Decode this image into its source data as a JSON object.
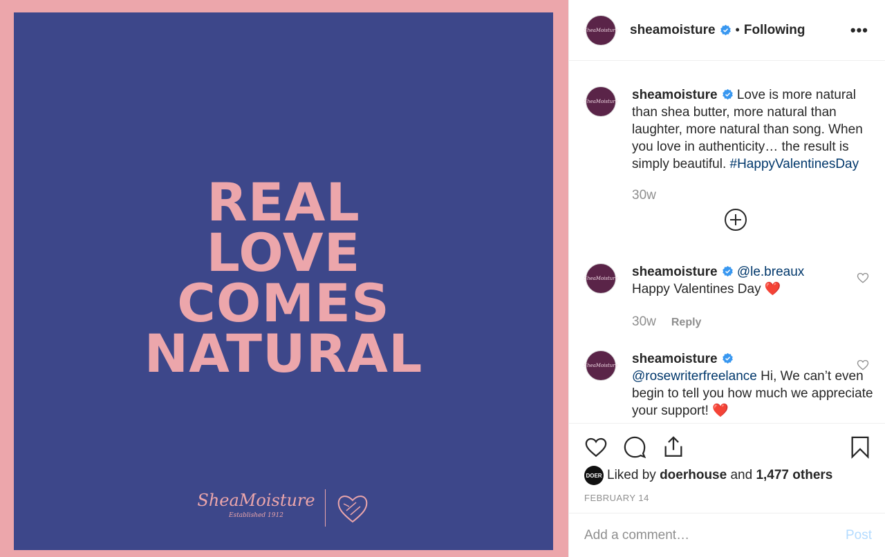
{
  "post_image": {
    "headline_lines": [
      "REAL",
      "LOVE",
      "COMES",
      "NATURAL"
    ],
    "brand_name": "SheaMoisture",
    "brand_tagline": "Established 1912",
    "colors": {
      "border": "#eca6ab",
      "background": "#3d478a",
      "text": "#eca6ab"
    }
  },
  "header": {
    "username": "sheamoisture",
    "dot": "•",
    "follow_status": "Following",
    "more": "•••"
  },
  "caption": {
    "username": "sheamoisture",
    "text": "Love is more natural than shea butter, more natural than laughter, more natural than song. When you love in authenticity… the result is simply beautiful.",
    "hashtag": "#HappyValentinesDay",
    "time": "30w"
  },
  "comments": [
    {
      "username": "sheamoisture",
      "mention": "@le.breaux",
      "text": "Happy Valentines Day",
      "emoji": "❤️",
      "time": "30w",
      "reply": "Reply"
    },
    {
      "username": "sheamoisture",
      "mention": "@rosewriterfreelance",
      "text": "Hi, We can’t even begin to tell you how much we appreciate your support!",
      "emoji": "❤️"
    }
  ],
  "likes": {
    "avatar_text": "DOER",
    "prefix": "Liked by",
    "user": "doerhouse",
    "and": "and",
    "others": "1,477 others"
  },
  "date": "FEBRUARY 14",
  "add_comment": {
    "placeholder": "Add a comment…",
    "post_label": "Post"
  },
  "icons": [
    "heart-icon",
    "comment-icon",
    "share-icon",
    "bookmark-icon",
    "verified-icon",
    "add-circle-icon"
  ]
}
